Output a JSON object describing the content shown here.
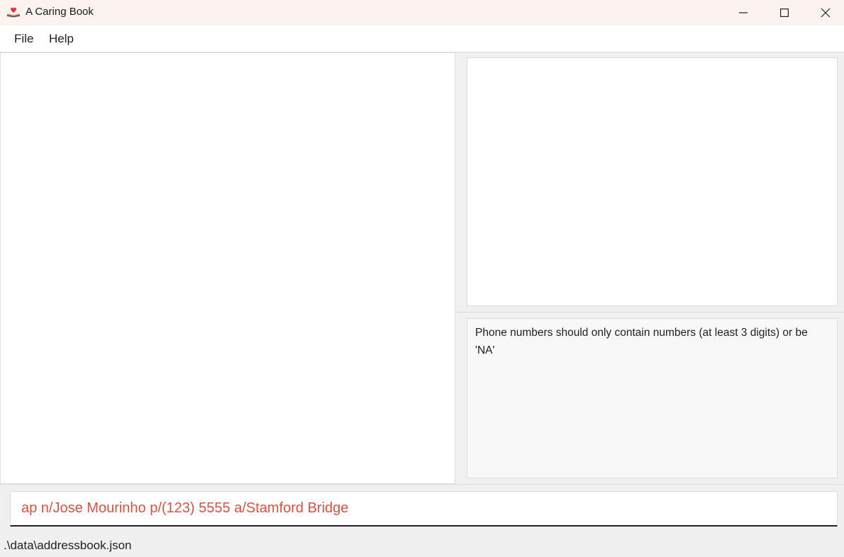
{
  "window": {
    "title": "A Caring Book",
    "app_icon": "book-heart-icon",
    "controls": [
      "minimize-icon",
      "maximize-icon",
      "close-icon"
    ]
  },
  "menu": {
    "items": [
      {
        "label": "File"
      },
      {
        "label": "Help"
      }
    ]
  },
  "result_display": {
    "message": "Phone numbers should only contain numbers (at least 3 digits) or be 'NA'"
  },
  "command_box": {
    "value": "ap n/Jose Mourinho p/(123) 5555 a/Stamford Bridge",
    "text_color": "#d9533e"
  },
  "status_bar": {
    "file_path": ".\\data\\addressbook.json"
  }
}
